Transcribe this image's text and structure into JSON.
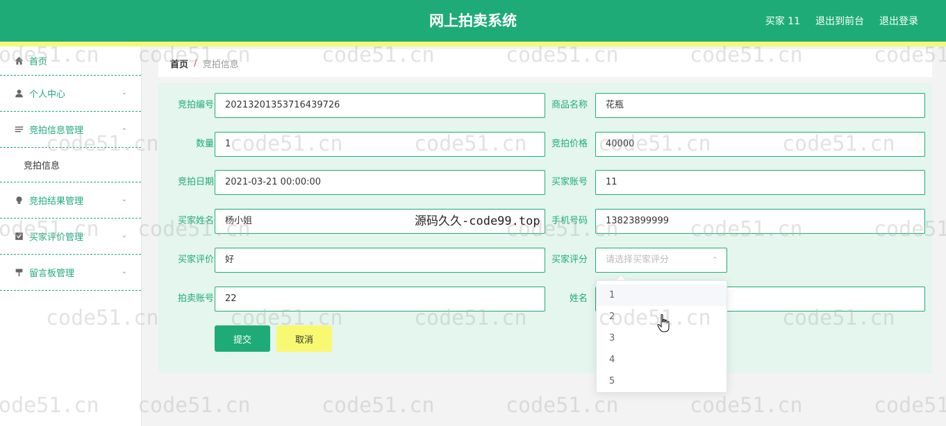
{
  "header": {
    "title": "网上拍卖系统",
    "user_label": "买家 11",
    "front_link": "退出到前台",
    "logout_link": "退出登录"
  },
  "sidebar": {
    "items": [
      {
        "label": "首页",
        "icon": "home-icon"
      },
      {
        "label": "个人中心",
        "icon": "user-icon"
      },
      {
        "label": "竞拍信息管理",
        "icon": "list-icon"
      },
      {
        "label": "竞拍结果管理",
        "icon": "bulb-icon"
      },
      {
        "label": "买家评价管理",
        "icon": "checkbox-icon"
      },
      {
        "label": "留言板管理",
        "icon": "pin-icon"
      }
    ],
    "submenu_item": "竞拍信息"
  },
  "breadcrumb": {
    "home": "首页",
    "separator": "/",
    "current": "竞拍信息"
  },
  "form": {
    "bid_no_label": "竞拍编号",
    "bid_no_value": "20213201353716439726",
    "goods_name_label": "商品名称",
    "goods_name_value": "花瓶",
    "quantity_label": "数量",
    "quantity_value": "1",
    "bid_price_label": "竞拍价格",
    "bid_price_value": "40000",
    "bid_date_label": "竞拍日期",
    "bid_date_value": "2021-03-21 00:00:00",
    "buyer_account_label": "买家账号",
    "buyer_account_value": "11",
    "buyer_name_label": "买家姓名",
    "buyer_name_value": "杨小姐",
    "phone_label": "手机号码",
    "phone_value": "13823899999",
    "buyer_comment_label": "买家评价",
    "buyer_comment_value": "好",
    "buyer_score_label": "买家评分",
    "buyer_score_placeholder": "请选择买家评分",
    "seller_account_label": "拍卖账号",
    "seller_account_value": "22",
    "name_label": "姓名",
    "name_value": "",
    "submit_label": "提交",
    "cancel_label": "取消"
  },
  "dropdown": {
    "options": [
      "1",
      "2",
      "3",
      "4",
      "5"
    ],
    "hovered_index": 0
  },
  "watermark": {
    "text": "code51.cn",
    "overlay": "源码久久-code99.top"
  },
  "colors": {
    "primary": "#1eab78",
    "accent_yellow": "#f9f871",
    "panel_bg": "#e4f6ee"
  }
}
